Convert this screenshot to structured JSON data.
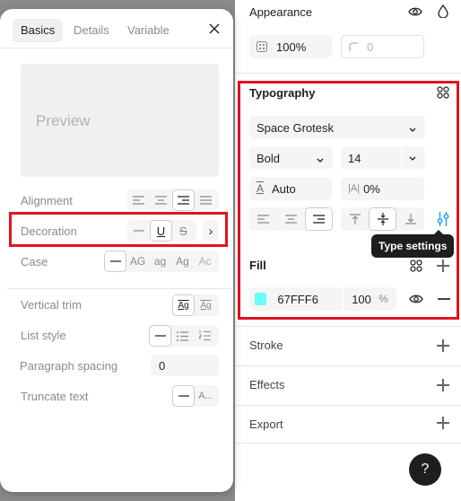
{
  "dialog": {
    "tabs": [
      {
        "label": "Basics",
        "active": true
      },
      {
        "label": "Details",
        "active": false
      },
      {
        "label": "Variable",
        "active": false
      }
    ],
    "preview_text": "Preview",
    "rows": {
      "alignment": "Alignment",
      "decoration": "Decoration",
      "case": "Case",
      "vertical_trim": "Vertical trim",
      "list_style": "List style",
      "paragraph_spacing": "Paragraph spacing",
      "truncate_text": "Truncate text"
    },
    "decoration_options": {
      "underline": "U",
      "strikethrough": "S",
      "more": "›"
    },
    "case_options": [
      "AG",
      "ag",
      "Ag",
      "Ac"
    ],
    "vertical_trim_options": [
      "Ag",
      "Ag"
    ],
    "paragraph_spacing_value": "0",
    "truncate_value": "A..."
  },
  "panel": {
    "appearance": {
      "title": "Appearance",
      "opacity": "100%",
      "corner_radius": "0"
    },
    "typography": {
      "title": "Typography",
      "font_family": "Space Grotesk",
      "font_weight": "Bold",
      "font_size": "14",
      "line_height": "Auto",
      "letter_spacing": "0%",
      "letter_spacing_prefix": "|A|",
      "line_height_prefix": "A"
    },
    "tooltip": "Type settings",
    "fill": {
      "title": "Fill",
      "color_hex": "67FFF6",
      "swatch_color": "#67FFF6",
      "opacity": "100",
      "opacity_unit": "%"
    },
    "stroke": {
      "title": "Stroke"
    },
    "effects": {
      "title": "Effects"
    },
    "export": {
      "title": "Export"
    },
    "help_label": "?"
  },
  "colors": {
    "highlight": "#E0141F",
    "tooltip_bg": "#1E1E1E"
  }
}
